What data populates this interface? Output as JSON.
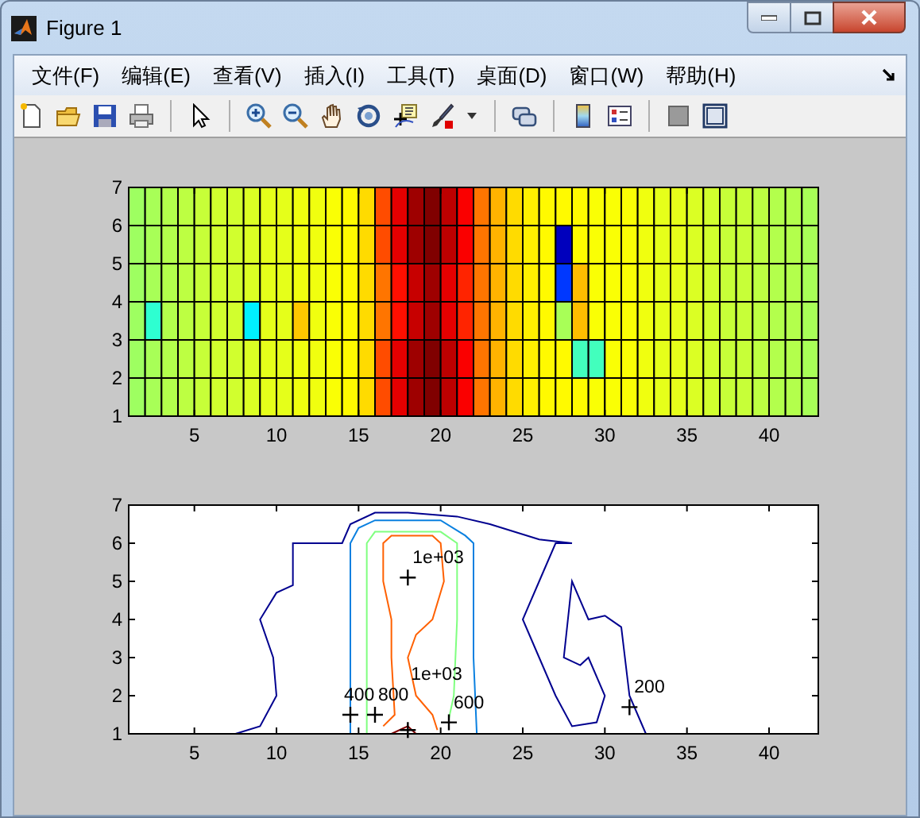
{
  "window": {
    "title": "Figure 1"
  },
  "menu": [
    {
      "label": "文件(F)"
    },
    {
      "label": "编辑(E)"
    },
    {
      "label": "查看(V)"
    },
    {
      "label": "插入(I)"
    },
    {
      "label": "工具(T)"
    },
    {
      "label": "桌面(D)"
    },
    {
      "label": "窗口(W)"
    },
    {
      "label": "帮助(H)"
    }
  ],
  "axes": [
    {
      "kind": "heatmap",
      "xticks": [
        "5",
        "10",
        "15",
        "20",
        "25",
        "30",
        "35",
        "40"
      ],
      "yticks": [
        "7",
        "6",
        "5",
        "4",
        "3",
        "2",
        "1"
      ]
    },
    {
      "kind": "contour",
      "xticks": [
        "5",
        "10",
        "15",
        "20",
        "25",
        "30",
        "35",
        "40"
      ],
      "yticks": [
        "7",
        "6",
        "5",
        "4",
        "3",
        "2",
        "1"
      ],
      "contour_labels": [
        {
          "text": "1e+03"
        },
        {
          "text": "400"
        },
        {
          "text": "800"
        },
        {
          "text": "1e+03"
        },
        {
          "text": "600"
        },
        {
          "text": "200"
        }
      ]
    }
  ]
}
